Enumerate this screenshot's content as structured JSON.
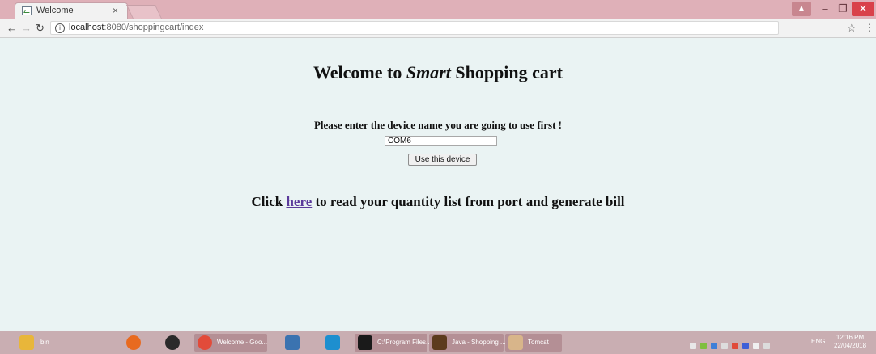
{
  "browser": {
    "tab_title": "Welcome",
    "tab_close": "×",
    "url_host": "localhost",
    "url_rest": ":8080/shoppingcart/index"
  },
  "page": {
    "heading_before": "Welcome to ",
    "heading_em": "Smart",
    "heading_after": " Shopping cart",
    "prompt": "Please enter the device name you are going to use first !",
    "device_input_value": "COM6",
    "device_button": "Use this device",
    "click_before": "Click ",
    "click_link": "here",
    "click_after": " to read your quantity list from port and generate bill"
  },
  "taskbar": {
    "bin": "bin",
    "chrome": "Welcome - Goo...",
    "cmd": "C:\\Program Files...",
    "java": "Java - Shopping ...",
    "tomcat": "Tomcat",
    "lang": "ENG",
    "time": "12:16 PM",
    "date": "22/04/2018"
  },
  "colors": {
    "tabstrip": "#dfb0b8",
    "page_bg": "#eaf3f3",
    "link": "#5b3a9b",
    "taskbar": "#c9aeb2"
  }
}
